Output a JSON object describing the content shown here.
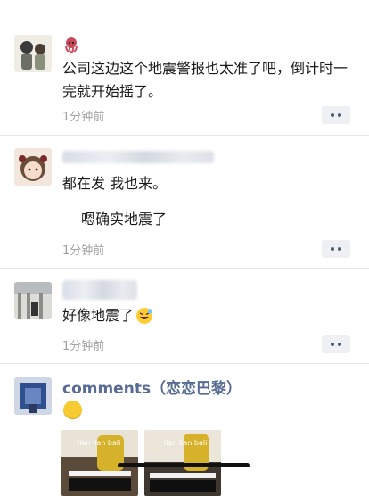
{
  "posts": [
    {
      "body": "公司这边这个地震警报也太准了吧，倒计时一完就开始摇了。",
      "time": "1分钟前"
    },
    {
      "body_line1": "都在发 我也来。",
      "body_line2": "嗯确实地震了",
      "time": "1分钟前"
    },
    {
      "body": "好像地震了",
      "time": "1分钟前"
    },
    {
      "nickname": "comments（恋恋巴黎）",
      "media_caption_1": "lian lian bali",
      "media_caption_2": "lian lian bali"
    }
  ],
  "colors": {
    "link": "#576b95",
    "timestamp": "#a3a3a3",
    "divider": "#e6e6e6"
  },
  "icons": [
    "octopus-icon",
    "grinning-sweat-emoji-icon",
    "yellow-circle-emoji-icon",
    "more-icon"
  ]
}
